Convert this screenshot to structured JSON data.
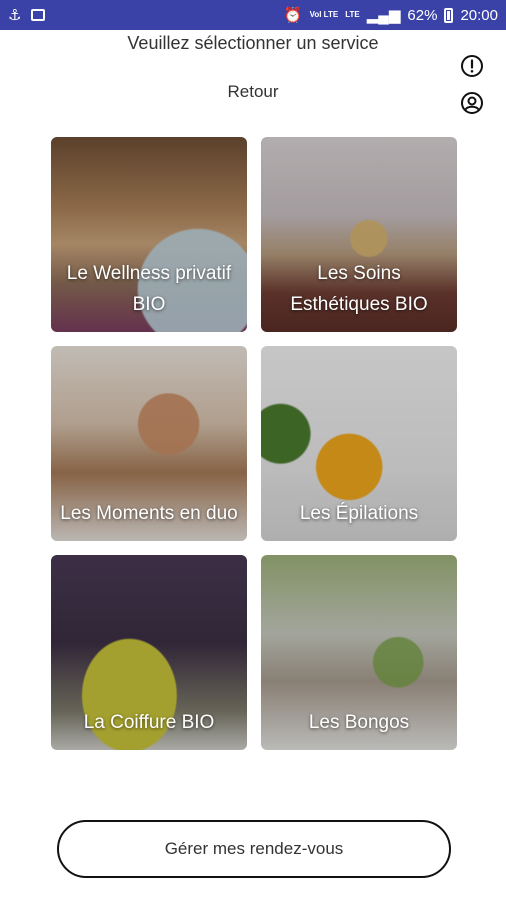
{
  "status_bar": {
    "battery": "62%",
    "time": "20:00",
    "volte": "Vol LTE",
    "lte": "LTE"
  },
  "header": {
    "title": "Veuillez sélectionner un service",
    "back_label": "Retour"
  },
  "services": [
    {
      "label": "Le Wellness privatif BIO"
    },
    {
      "label": "Les Soins Esthétiques BIO"
    },
    {
      "label": "Les Moments en duo"
    },
    {
      "label": "Les Épilations"
    },
    {
      "label": "La Coiffure BIO"
    },
    {
      "label": "Les Bongos"
    }
  ],
  "footer": {
    "manage_label": "Gérer mes rendez-vous"
  },
  "icons": {
    "info": "info-circle-icon",
    "user": "user-circle-icon"
  },
  "colors": {
    "status_bar": "#3a42a8",
    "button_border": "#111111"
  }
}
